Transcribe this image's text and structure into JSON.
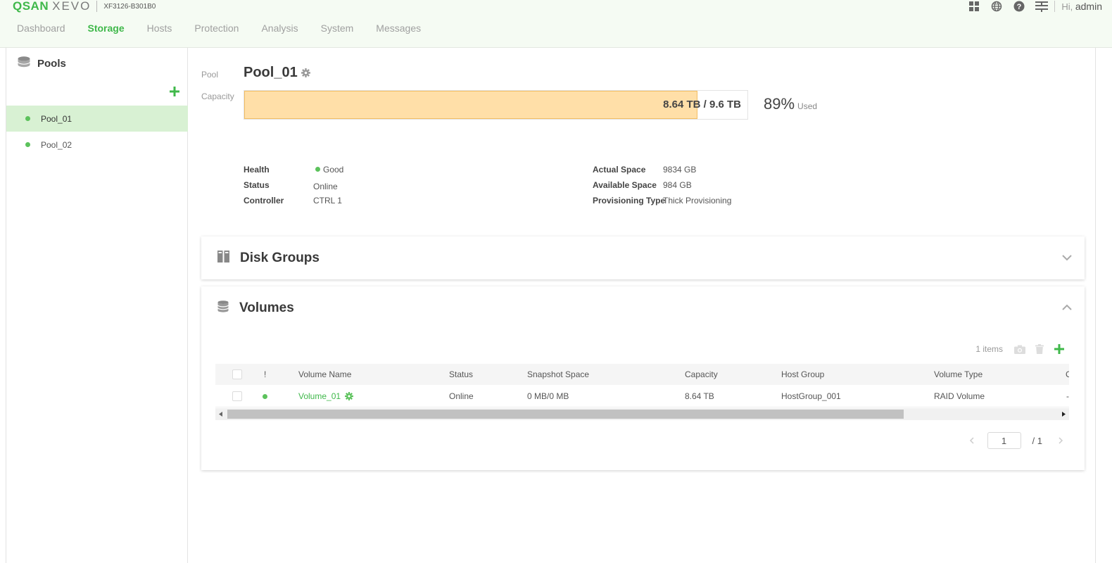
{
  "brand": {
    "logo_primary": "QSAN",
    "logo_secondary": "XEVO",
    "model": "XF3126-B301B0"
  },
  "header": {
    "icons": [
      "apps-grid-icon",
      "globe-icon",
      "help-icon",
      "server-stack-icon"
    ],
    "greeting": "Hi,",
    "username": "admin"
  },
  "nav": {
    "items": [
      {
        "label": "Dashboard",
        "active": false
      },
      {
        "label": "Storage",
        "active": true
      },
      {
        "label": "Hosts",
        "active": false
      },
      {
        "label": "Protection",
        "active": false
      },
      {
        "label": "Analysis",
        "active": false
      },
      {
        "label": "System",
        "active": false
      },
      {
        "label": "Messages",
        "active": false
      }
    ]
  },
  "sidebar": {
    "title": "Pools",
    "items": [
      {
        "label": "Pool_01",
        "active": true
      },
      {
        "label": "Pool_02",
        "active": false
      }
    ]
  },
  "pool": {
    "label": "Pool",
    "name": "Pool_01",
    "capacity_label": "Capacity",
    "capacity_text": "8.64 TB / 9.6 TB",
    "used_fraction": 0.9,
    "used_percent": "89",
    "used_unit": "%",
    "used_label": "Used",
    "info_left": [
      {
        "key": "Health",
        "value": "Good"
      },
      {
        "key": "Status",
        "value": "Online"
      },
      {
        "key": "Controller",
        "value": "CTRL 1"
      }
    ],
    "info_right": [
      {
        "key": "Actual Space",
        "value": "9834 GB"
      },
      {
        "key": "Available Space",
        "value": "984 GB"
      },
      {
        "key": "Provisioning Type",
        "value": "Thick Provisioning"
      }
    ]
  },
  "disk_groups": {
    "title": "Disk Groups",
    "expanded": false
  },
  "volumes": {
    "title": "Volumes",
    "expanded": true,
    "items_count": "1 items",
    "columns": [
      "!",
      "Volume Name",
      "Status",
      "Snapshot Space",
      "Capacity",
      "Host Group",
      "Volume Type",
      "C"
    ],
    "rows": [
      {
        "name": "Volume_01",
        "status": "Online",
        "snapshot_space": "0 MB/0 MB",
        "capacity": "8.64 TB",
        "host_group": "HostGroup_001",
        "volume_type": "RAID Volume",
        "extra": "-"
      }
    ],
    "pagination": {
      "current": "1",
      "total": "/  1"
    }
  },
  "colors": {
    "accent": "#3fb84a",
    "capacity_fill": "#ffdfa8",
    "capacity_border": "#f3bd63",
    "active_row": "#d8f1d3"
  }
}
